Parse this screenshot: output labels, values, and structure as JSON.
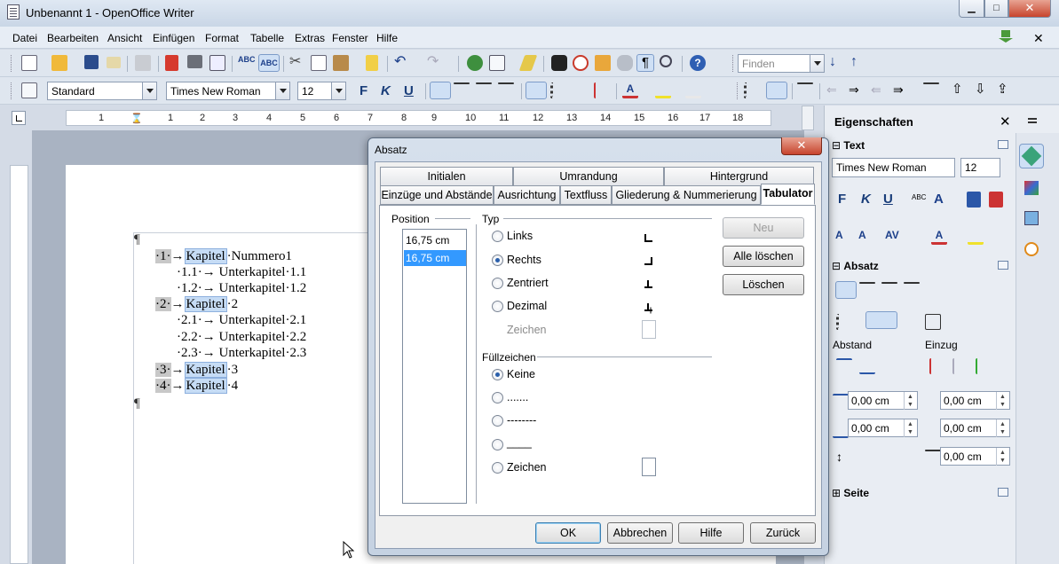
{
  "window": {
    "title": "Unbenannt 1 - OpenOffice Writer",
    "minimize": "▁",
    "maximize": "□",
    "close": "✕"
  },
  "menu": [
    "Datei",
    "Bearbeiten",
    "Ansicht",
    "Einfügen",
    "Format",
    "Tabelle",
    "Extras",
    "Fenster",
    "Hilfe"
  ],
  "menu_close": "✕",
  "toolbar1": {
    "find_placeholder": "Finden"
  },
  "toolbar2": {
    "style": "Standard",
    "font": "Times New Roman",
    "size": "12",
    "bold": "F",
    "italic": "K",
    "underline": "U"
  },
  "ruler": {
    "numbers": [
      "1",
      "1",
      "2",
      "3",
      "4",
      "5",
      "6",
      "7",
      "8",
      "9",
      "10",
      "11",
      "12",
      "13",
      "14",
      "15",
      "16",
      "17",
      "18"
    ]
  },
  "document": {
    "lines": [
      {
        "num": "·1·",
        "kap": "Kapitel",
        "rest": "·Nummero1"
      },
      {
        "indent": "·1.1·→ Unterkapitel·1.1"
      },
      {
        "indent": "·1.2·→ Unterkapitel·1.2"
      },
      {
        "num": "·2·",
        "kap": "Kapitel",
        "rest": "·2"
      },
      {
        "indent": "·2.1·→ Unterkapitel·2.1"
      },
      {
        "indent": "·2.2·→ Unterkapitel·2.2"
      },
      {
        "indent": "·2.3·→ Unterkapitel·2.3"
      },
      {
        "num": "·3·",
        "kap": "Kapitel",
        "rest": "·3"
      },
      {
        "num": "·4·",
        "kap": "Kapitel",
        "rest": "·4"
      }
    ],
    "pilcrow": "¶"
  },
  "sidebar": {
    "title": "Eigenschaften",
    "close": "✕",
    "text_section": "Text",
    "font": "Times New Roman",
    "size": "12",
    "paragraph_section": "Absatz",
    "spacing_label": "Abstand",
    "indent_label": "Einzug",
    "spacing_above": "0,00 cm",
    "spacing_below": "0,00 cm",
    "indent_before": "0,00 cm",
    "indent_after": "0,00 cm",
    "indent_first": "0,00 cm",
    "page_section": "Seite"
  },
  "dialog": {
    "title": "Absatz",
    "close": "✕",
    "tabs_row1": [
      "Initialen",
      "Umrandung",
      "Hintergrund"
    ],
    "tabs_row2": [
      "Einzüge und Abstände",
      "Ausrichtung",
      "Textfluss",
      "Gliederung & Nummerierung",
      "Tabulator"
    ],
    "position_label": "Position",
    "position_input": "16,75 cm",
    "position_list": [
      "16,75 cm"
    ],
    "type_label": "Typ",
    "types": [
      {
        "label": "Links",
        "selected": false
      },
      {
        "label": "Rechts",
        "selected": true
      },
      {
        "label": "Zentriert",
        "selected": false
      },
      {
        "label": "Dezimal",
        "selected": false
      }
    ],
    "type_char_label": "Zeichen",
    "fill_label": "Füllzeichen",
    "fills": [
      {
        "label": "Keine",
        "selected": true
      },
      {
        "label": ".......",
        "selected": false
      },
      {
        "label": "--------",
        "selected": false
      },
      {
        "label": "____",
        "selected": false
      },
      {
        "label": "Zeichen",
        "selected": false
      }
    ],
    "buttons_right": [
      "Neu",
      "Alle löschen",
      "Löschen"
    ],
    "buttons_bottom": [
      "OK",
      "Abbrechen",
      "Hilfe",
      "Zurück"
    ]
  }
}
